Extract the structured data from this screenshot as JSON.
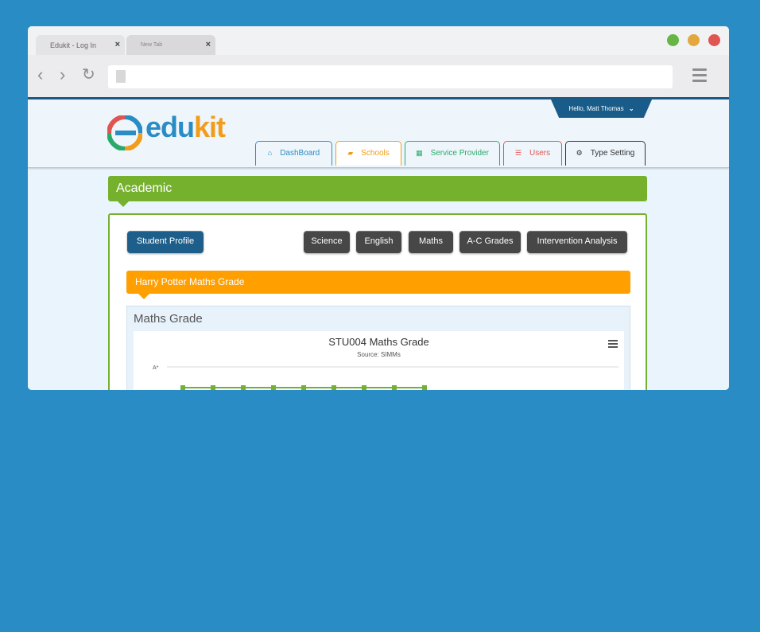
{
  "browser": {
    "tabs": [
      {
        "label": "Edukit - Log In"
      },
      {
        "label": "New Tab"
      }
    ],
    "window_buttons": {
      "green": "#67b543",
      "yellow": "#e3a73e",
      "red": "#e05452"
    }
  },
  "app": {
    "greeting": "Hello, Matt Thomas",
    "logo": {
      "prefix": "edu",
      "suffix": "kit",
      "prefix_color": "#2a8cc5",
      "suffix_color": "#f29c1b"
    },
    "nav_tabs": [
      {
        "label": "DashBoard",
        "icon": "home-icon",
        "color": "#2a8cc5"
      },
      {
        "label": "Schools",
        "icon": "book-icon",
        "color": "#f29c1b"
      },
      {
        "label": "Service Provider",
        "icon": "grid-icon",
        "color": "#2aaa6a"
      },
      {
        "label": "Users",
        "icon": "users-icon",
        "color": "#e05452"
      },
      {
        "label": "Type Setting",
        "icon": "gear-icon",
        "color": "#333333"
      }
    ],
    "section_title": "Academic",
    "student_profile_label": "Student Profile",
    "subject_buttons": [
      "Science",
      "English",
      "Maths",
      "A-C Grades",
      "Intervention Analysis"
    ],
    "banner": "Harry Potter Maths Grade",
    "grade_title": "Maths Grade"
  },
  "chart_data": {
    "type": "line",
    "title": "STU004 Maths Grade",
    "subtitle": "Source: SIMMs",
    "y_tick_labels": [
      "A*"
    ],
    "series": [
      {
        "values": [
          "A",
          "A",
          "A",
          "A",
          "A",
          "A",
          "A",
          "A",
          "A"
        ],
        "color": "#76b12e"
      }
    ]
  }
}
